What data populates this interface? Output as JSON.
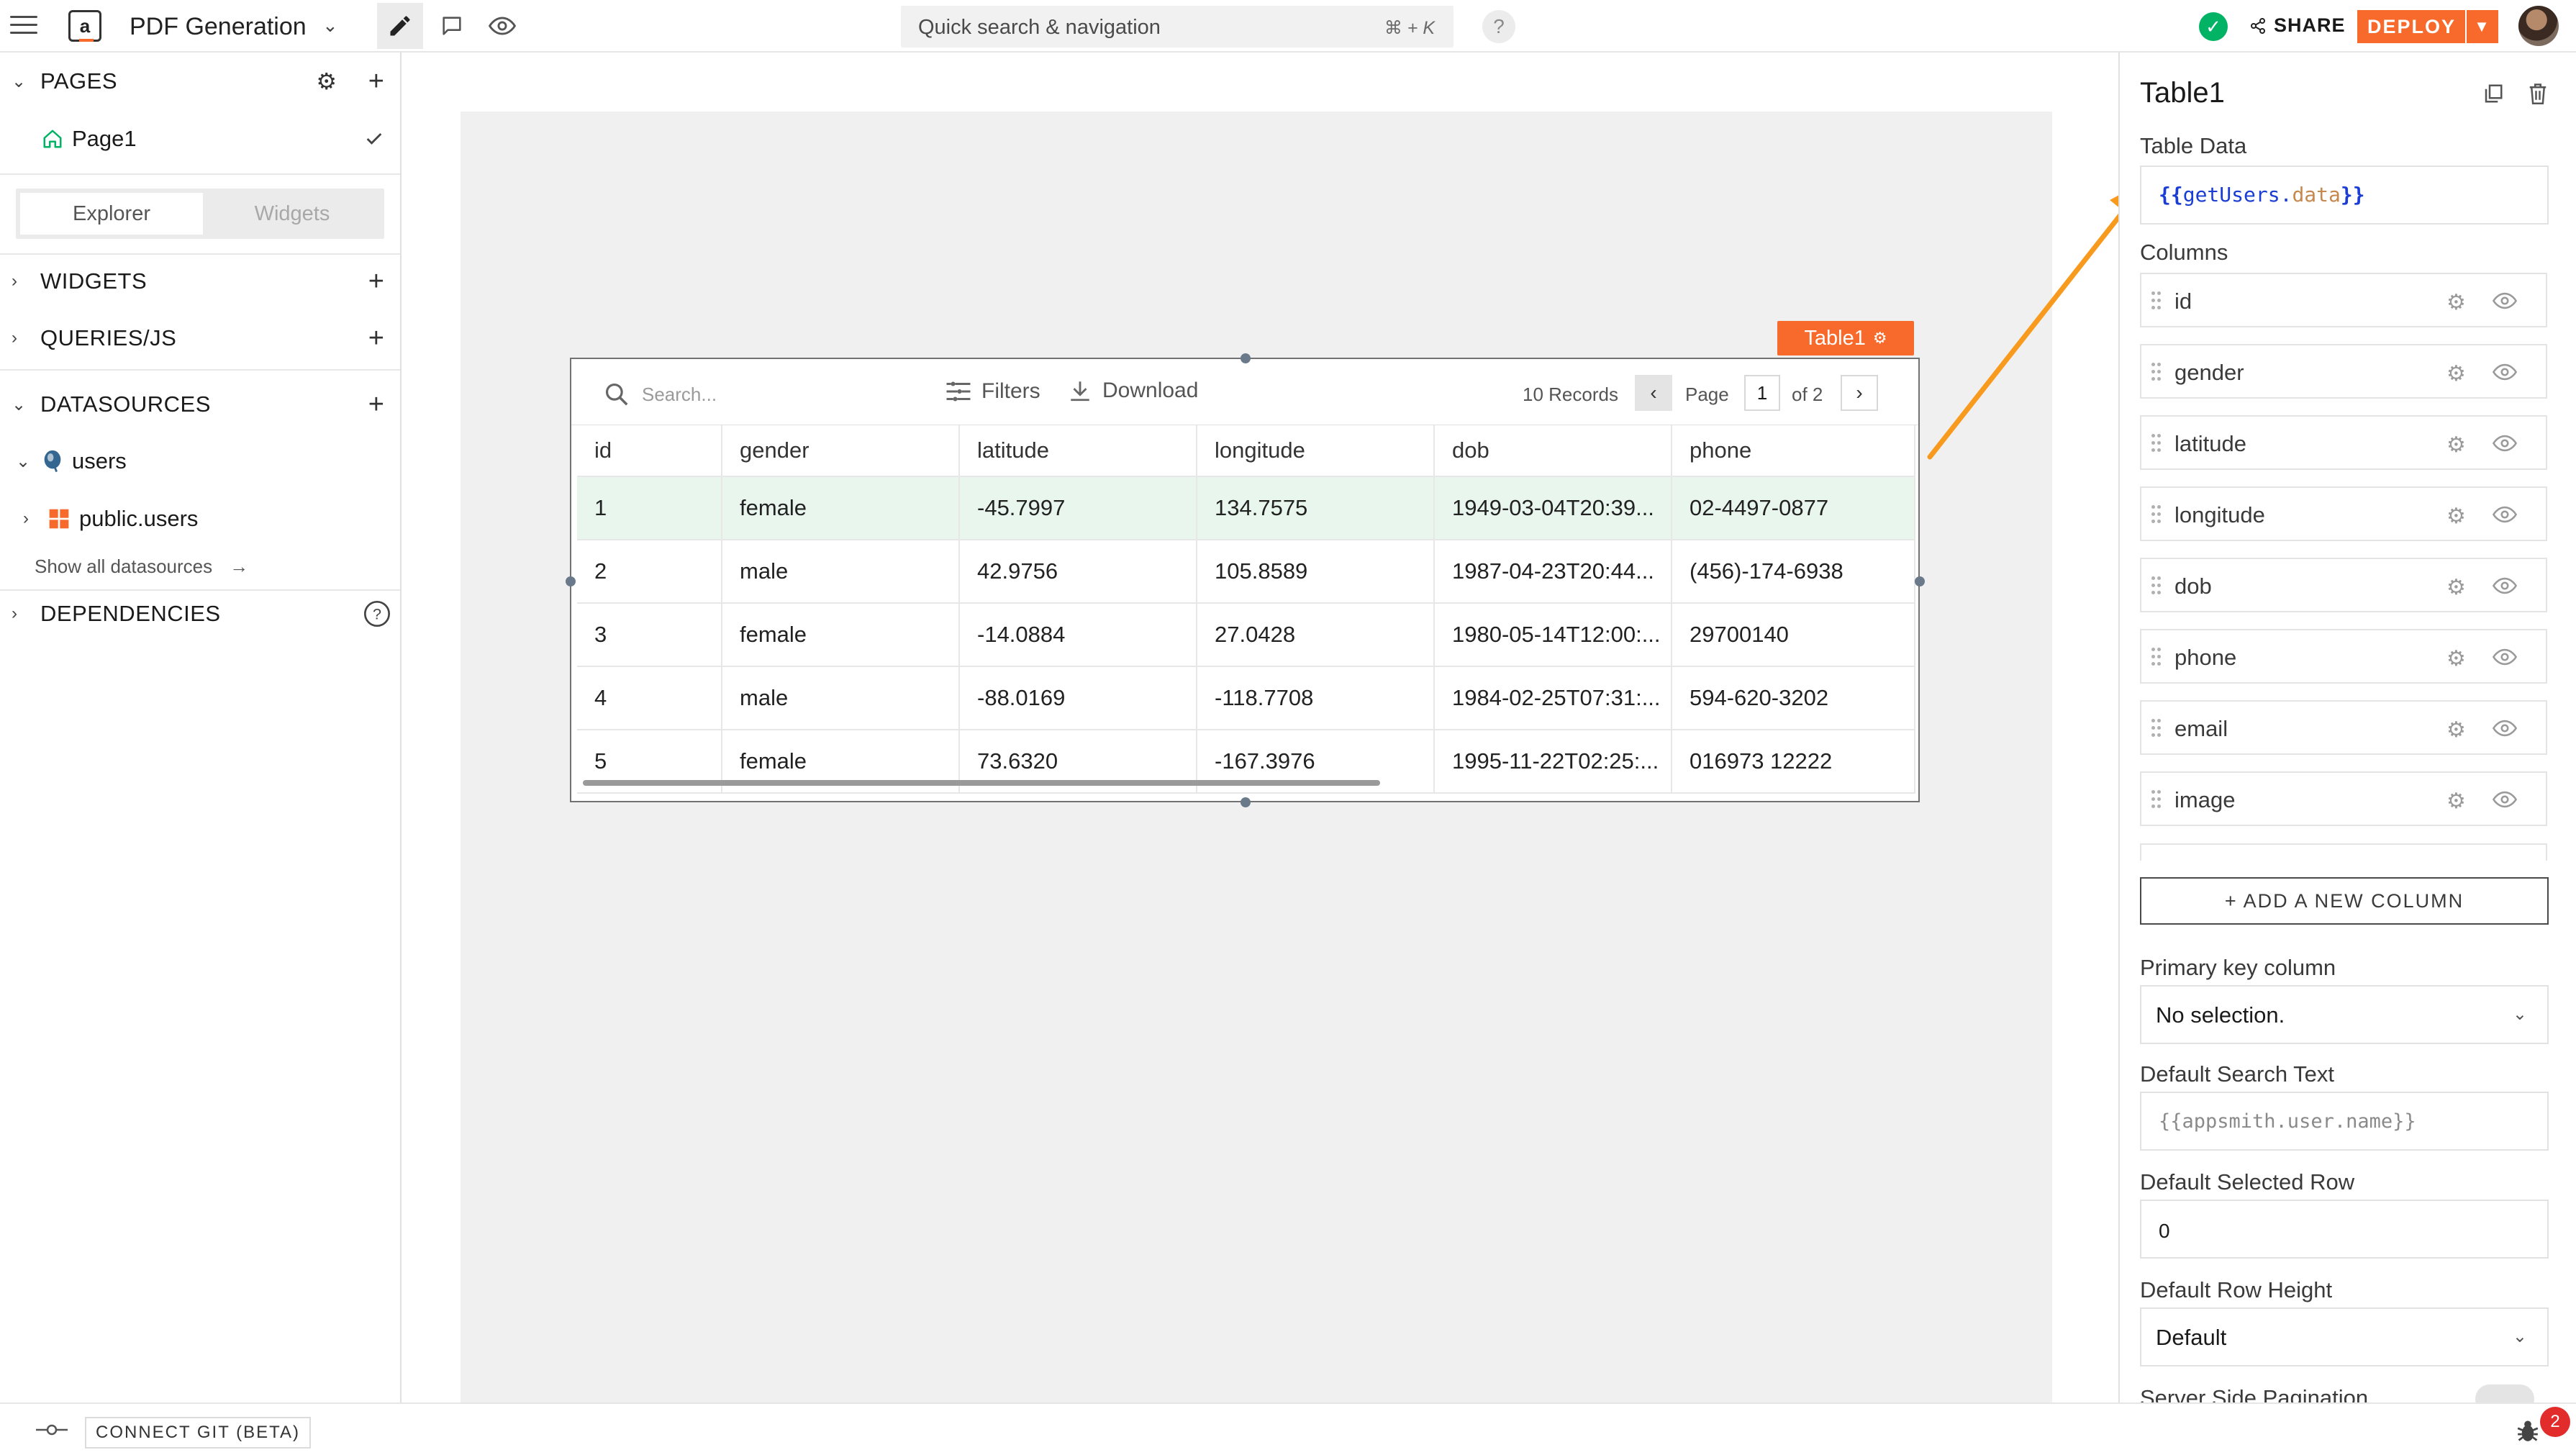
{
  "header": {
    "app_title": "PDF Generation",
    "search_label": "Quick search & navigation",
    "search_shortcut": "⌘ + K",
    "help": "?",
    "share": "SHARE",
    "deploy": "DEPLOY",
    "status": "✓"
  },
  "sidebar": {
    "pages_head": "PAGES",
    "page1": "Page1",
    "tab_explorer": "Explorer",
    "tab_widgets": "Widgets",
    "widgets_head": "WIDGETS",
    "queries_head": "QUERIES/JS",
    "datasources_head": "DATASOURCES",
    "ds_users": "users",
    "ds_table": "public.users",
    "show_all": "Show all datasources",
    "dependencies_head": "DEPENDENCIES"
  },
  "table": {
    "widget_label": "Table1",
    "search_placeholder": "Search...",
    "filters": "Filters",
    "download": "Download",
    "records": "10 Records",
    "page_label": "Page",
    "page_num": "1",
    "page_of": "of 2",
    "columns": [
      "id",
      "gender",
      "latitude",
      "longitude",
      "dob",
      "phone"
    ],
    "rows": [
      [
        "1",
        "female",
        "-45.7997",
        "134.7575",
        "1949-03-04T20:39...",
        "02-4497-0877"
      ],
      [
        "2",
        "male",
        "42.9756",
        "105.8589",
        "1987-04-23T20:44...",
        "(456)-174-6938"
      ],
      [
        "3",
        "female",
        "-14.0884",
        "27.0428",
        "1980-05-14T12:00:...",
        "29700140"
      ],
      [
        "4",
        "male",
        "-88.0169",
        "-118.7708",
        "1984-02-25T07:31:...",
        "594-620-3202"
      ],
      [
        "5",
        "female",
        "73.6320",
        "-167.3976",
        "1995-11-22T02:25:...",
        "016973 12222"
      ]
    ]
  },
  "props": {
    "title": "Table1",
    "table_data_label": "Table Data",
    "code_open": "{{",
    "code_obj": "getUsers",
    "code_dot": ".",
    "code_field": "data",
    "code_close": "}}",
    "columns_label": "Columns",
    "column_items": [
      "id",
      "gender",
      "latitude",
      "longitude",
      "dob",
      "phone",
      "email",
      "image"
    ],
    "add_column": "+ ADD A NEW COLUMN",
    "primary_key_label": "Primary key column",
    "primary_key_value": "No selection.",
    "default_search_label": "Default Search Text",
    "default_search_placeholder": "{{appsmith.user.name}}",
    "default_row_label": "Default Selected Row",
    "default_row_value": "0",
    "row_height_label": "Default Row Height",
    "row_height_value": "Default",
    "server_pagination_label": "Server Side Pagination"
  },
  "footer": {
    "connect_git": "CONNECT GIT (BETA)",
    "debug_count": "2"
  },
  "colors": {
    "accent": "#f86a2b",
    "success": "#03b365",
    "selected_row": "#e8f6ee"
  }
}
